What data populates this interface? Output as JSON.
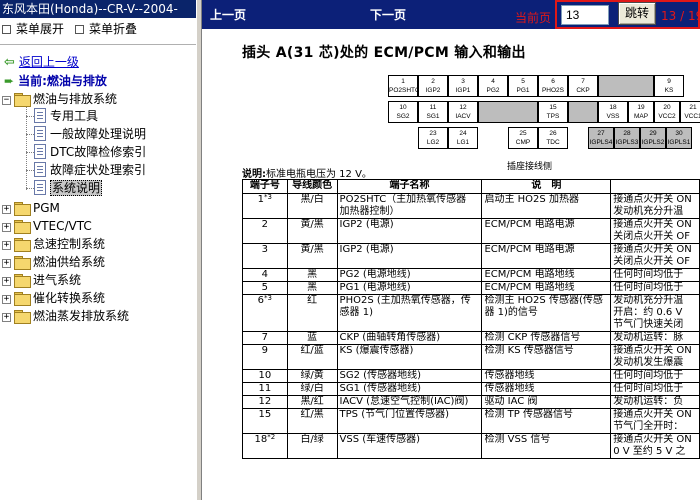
{
  "window_title": "东风本田(Honda)--CR-V--2004-",
  "menu": {
    "expand_label": "菜单展开",
    "collapse_label": "菜单折叠"
  },
  "back_link": "返回上一级",
  "current_label": "当前:燃油与排放",
  "tree": {
    "root": "燃油与排放系统",
    "children": [
      "专用工具",
      "一般故障处理说明",
      "DTC故障检修索引",
      "故障症状处理索引",
      "系统说明"
    ],
    "siblings": [
      "PGM",
      "VTEC/VTC",
      "怠速控制系统",
      "燃油供给系统",
      "进气系统",
      "催化转换系统",
      "燃油蒸发排放系统"
    ]
  },
  "nav": {
    "prev_label": "上一页",
    "next_label": "下一页",
    "current_page_label": "当前页",
    "page_value": "13",
    "jump_label": "跳转",
    "page_count": "13 / 19"
  },
  "document": {
    "title": "插头 A(31 芯)处的 ECM/PCM 输入和输出",
    "connector_caption": "插座接线侧",
    "connector_pins_top": [
      {
        "num": "1",
        "name": "PO2SHTC"
      },
      {
        "num": "2",
        "name": "IGP2"
      },
      {
        "num": "3",
        "name": "IGP1"
      },
      {
        "num": "4",
        "name": "PG2"
      },
      {
        "num": "5",
        "name": "PG1"
      },
      {
        "num": "6",
        "name": "PHO2S"
      },
      {
        "num": "7",
        "name": "CKP"
      },
      {
        "num": "9",
        "name": "KS"
      }
    ],
    "connector_pins_mid": [
      {
        "num": "10",
        "name": "SG2"
      },
      {
        "num": "11",
        "name": "SG1"
      },
      {
        "num": "12",
        "name": "IACV"
      },
      {
        "num": "15",
        "name": "TPS"
      },
      {
        "num": "18",
        "name": "VSS"
      },
      {
        "num": "19",
        "name": "MAP"
      },
      {
        "num": "20",
        "name": "VCC2"
      },
      {
        "num": "21",
        "name": "VCC1"
      }
    ],
    "connector_pins_bottom": [
      {
        "num": "23",
        "name": "LG2"
      },
      {
        "num": "24",
        "name": "LG1"
      },
      {
        "num": "25",
        "name": "CMP"
      },
      {
        "num": "26",
        "name": "TDC"
      },
      {
        "num": "27",
        "name": "IGPLS4"
      },
      {
        "num": "28",
        "name": "IGPLS3"
      },
      {
        "num": "29",
        "name": "IGPLS2"
      },
      {
        "num": "30",
        "name": "IGPLS1"
      }
    ],
    "note_label": "说明:",
    "note_text": "标准电瓶电压为 12 V。",
    "table_headers": [
      "端子号",
      "导线颜色",
      "端子名称",
      "说　明",
      ""
    ],
    "rows": [
      {
        "pin": "1",
        "sup": "*3",
        "color": "黑/白",
        "name": [
          "PO2SHTC（主加热氧传感器",
          "加热器控制）"
        ],
        "desc": [
          "启动主 HO2S 加热器"
        ],
        "cond": [
          "接通点火开关 ON",
          "发动机充分升温"
        ]
      },
      {
        "pin": "2",
        "sup": "",
        "color": "黄/黑",
        "name": [
          "IGP2 (电源)"
        ],
        "desc": [
          "ECM/PCM 电路电源"
        ],
        "cond": [
          "接通点火开关 ON",
          "关闭点火开关 OF"
        ]
      },
      {
        "pin": "3",
        "sup": "",
        "color": "黄/黑",
        "name": [
          "IGP2 (电源)"
        ],
        "desc": [
          "ECM/PCM 电路电源"
        ],
        "cond": [
          "接通点火开关 ON",
          "关闭点火开关 OF"
        ]
      },
      {
        "pin": "4",
        "sup": "",
        "color": "黑",
        "name": [
          "PG2 (电源地线)"
        ],
        "desc": [
          "ECM/PCM 电路地线"
        ],
        "cond": [
          "任何时间均低于"
        ]
      },
      {
        "pin": "5",
        "sup": "",
        "color": "黑",
        "name": [
          "PG1 (电源地线)"
        ],
        "desc": [
          "ECM/PCM 电路地线"
        ],
        "cond": [
          "任何时间均低于"
        ]
      },
      {
        "pin": "6",
        "sup": "*3",
        "color": "红",
        "name": [
          "PHO2S (主加热氧传感器，传",
          "感器 1)"
        ],
        "desc": [
          "检测主 HO2S 传感器(传感",
          "器 1)的信号"
        ],
        "cond": [
          "发动机充分升温",
          "开启：约 0.6 V",
          "节气门快速关闭"
        ]
      },
      {
        "pin": "7",
        "sup": "",
        "color": "蓝",
        "name": [
          "CKP (曲轴转角传感器)"
        ],
        "desc": [
          "检测 CKP 传感器信号"
        ],
        "cond": [
          "发动机运转：脉"
        ]
      },
      {
        "pin": "9",
        "sup": "",
        "color": "红/蓝",
        "name": [
          "KS (爆震传感器)"
        ],
        "desc": [
          "检测 KS 传感器信号"
        ],
        "cond": [
          "接通点火开关 ON",
          "发动机发生爆震"
        ]
      },
      {
        "pin": "10",
        "sup": "",
        "color": "绿/黄",
        "name": [
          "SG2 (传感器地线)"
        ],
        "desc": [
          "传感器地线"
        ],
        "cond": [
          "任何时间均低于"
        ]
      },
      {
        "pin": "11",
        "sup": "",
        "color": "绿/白",
        "name": [
          "SG1 (传感器地线)"
        ],
        "desc": [
          "传感器地线"
        ],
        "cond": [
          "任何时间均低于"
        ]
      },
      {
        "pin": "12",
        "sup": "",
        "color": "黑/红",
        "name": [
          "IACV (怠速空气控制(IAC)阀)"
        ],
        "desc": [
          "驱动 IAC 阀"
        ],
        "cond": [
          "发动机运转：负"
        ]
      },
      {
        "pin": "15",
        "sup": "",
        "color": "红/黑",
        "name": [
          "TPS (节气门位置传感器)"
        ],
        "desc": [
          "检测 TP 传感器信号"
        ],
        "cond": [
          "接通点火开关 ON",
          "节气门全开时："
        ]
      },
      {
        "pin": "18",
        "sup": "*2",
        "color": "白/绿",
        "name": [
          "VSS (车速传感器)"
        ],
        "desc": [
          "检测 VSS 信号"
        ],
        "cond": [
          "接通点火开关 ON",
          "0 V 至约 5 V 之"
        ]
      }
    ]
  }
}
